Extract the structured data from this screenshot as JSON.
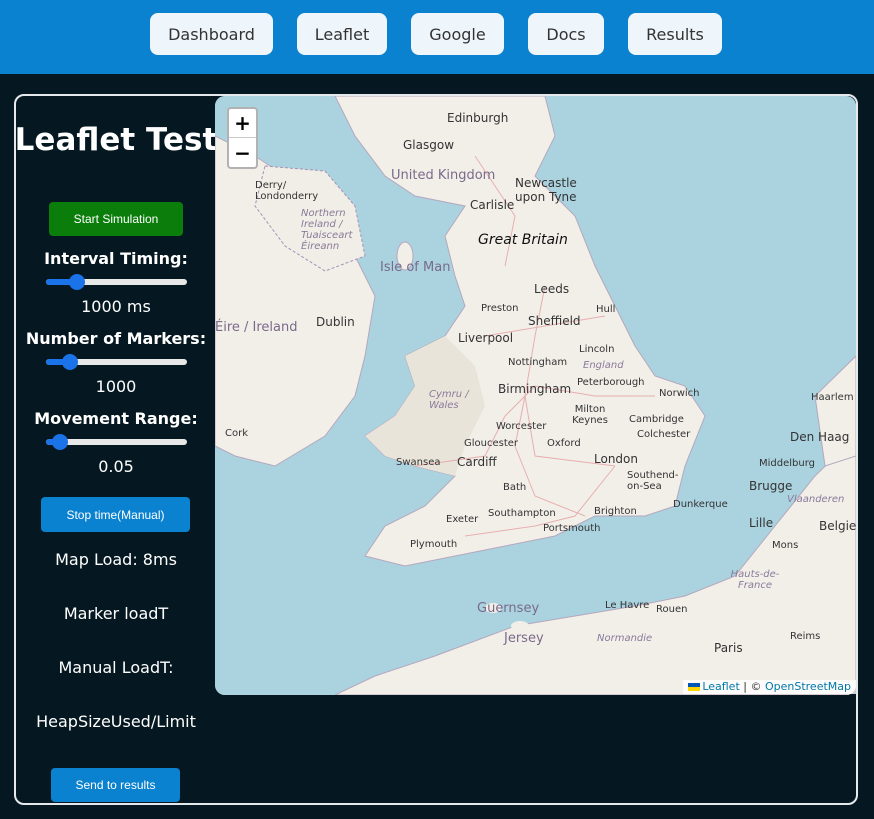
{
  "nav": {
    "items": [
      {
        "label": "Dashboard"
      },
      {
        "label": "Leaflet"
      },
      {
        "label": "Google"
      },
      {
        "label": "Docs"
      },
      {
        "label": "Results"
      }
    ]
  },
  "sidebar": {
    "title": "Leaflet Test",
    "start_button": "Start Simulation",
    "interval_label": "Interval Timing:",
    "interval_value": "1000 ms",
    "interval_level": 0.18,
    "markers_label": "Number of Markers:",
    "markers_value": "1000",
    "markers_level": 0.13,
    "range_label": "Movement Range:",
    "range_value": "0.05",
    "range_level": 0.05,
    "stop_button": "Stop time(Manual)",
    "map_load": "Map Load: 8ms",
    "marker_load": "Marker loadT",
    "manual_load": "Manual LoadT:",
    "heap": "HeapSizeUsed/Limit",
    "send_button": "Send to results"
  },
  "map": {
    "zoom_in": "+",
    "zoom_out": "−",
    "attribution_leaflet": "Leaflet",
    "attribution_sep": " | © ",
    "attribution_osm": "OpenStreetMap",
    "labels": [
      "Edinburgh",
      "Glasgow",
      "United Kingdom",
      "Newcastle upon Tyne",
      "Derry/ Londonderry",
      "Northern Ireland / Tuaisceart Éireann",
      "Carlisle",
      "Great Britain",
      "Isle of Man",
      "Éire / Ireland",
      "Dublin",
      "Leeds",
      "Preston",
      "Hull",
      "Sheffield",
      "Liverpool",
      "Nottingham",
      "Lincoln",
      "England",
      "Birmingham",
      "Peterborough",
      "Norwich",
      "Cymru / Wales",
      "Milton Keynes",
      "Cambridge",
      "Worcester",
      "Colchester",
      "Gloucester",
      "Oxford",
      "Cork",
      "Swansea",
      "Cardiff",
      "London",
      "Southend-on-Sea",
      "Bath",
      "Exeter",
      "Southampton",
      "Brighton",
      "Portsmouth",
      "Plymouth",
      "Dunkerque",
      "Haarlem",
      "Den Haag",
      "Middelburg",
      "Brugge",
      "Vlaanderen",
      "Lille",
      "Belgie",
      "Mons",
      "Hauts-de-France",
      "Guernsey",
      "Jersey",
      "Le Havre",
      "Rouen",
      "Normandie",
      "Reims",
      "Paris"
    ]
  },
  "colors": {
    "topbar": "#0b82cf",
    "background": "#051821",
    "sea": "#aad3df",
    "land": "#f2efe9",
    "start_button": "#0b7d0b",
    "accent": "#1a73e8"
  }
}
